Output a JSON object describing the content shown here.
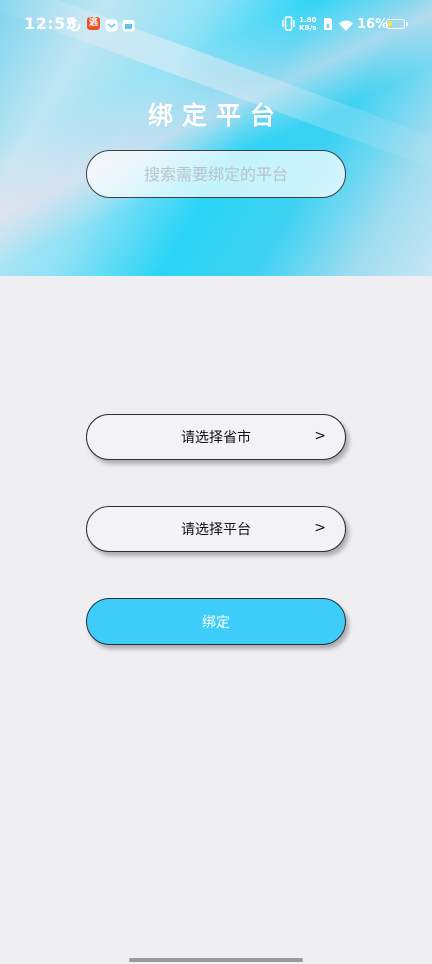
{
  "status_bar": {
    "time": "12:55",
    "net_speed_value": "1.80",
    "net_speed_unit": "KB/s",
    "battery_percent": "16%",
    "app_badge_text": "逃"
  },
  "header": {
    "title": "绑定平台",
    "search_placeholder": "搜索需要绑定的平台",
    "search_value": ""
  },
  "form": {
    "province_city_label": "请选择省市",
    "platform_label": "请选择平台",
    "arrow": ">",
    "bind_label": "绑定"
  },
  "colors": {
    "accent": "#3dcdf8",
    "background": "#efeef3",
    "battery_level": "#f7e34b",
    "badge": "#e8552b"
  }
}
